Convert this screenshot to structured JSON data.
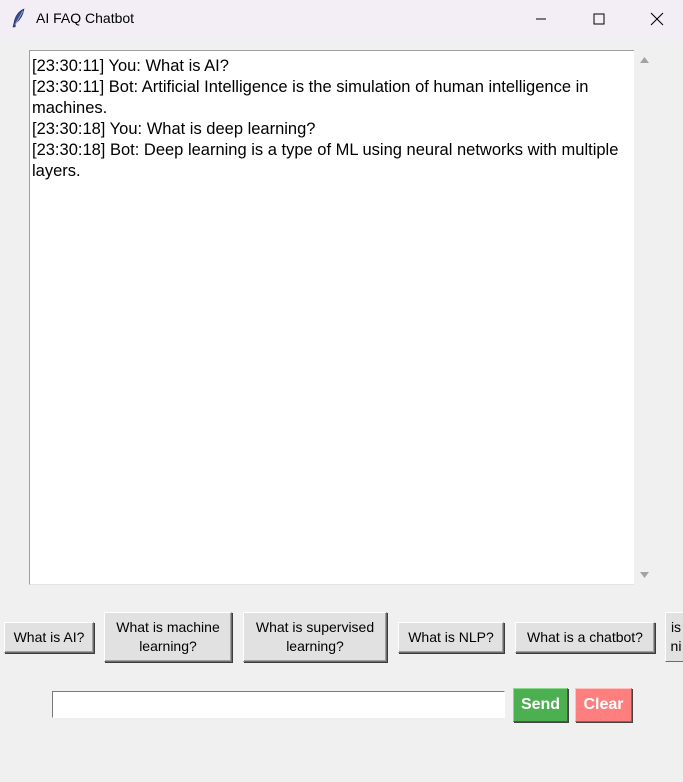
{
  "window": {
    "title": "AI FAQ Chatbot",
    "icon": "feather-icon",
    "controls": [
      "minimize-icon",
      "maximize-icon",
      "close-icon"
    ]
  },
  "chat": {
    "lines": [
      "[23:30:11] You: What is AI?",
      "[23:30:11] Bot: Artificial Intelligence is the simulation of human intelligence in machines.",
      "[23:30:18] You: What is deep learning?",
      "[23:30:18] Bot: Deep learning is a type of ML using neural networks with multiple layers."
    ]
  },
  "quick_questions": [
    "What is AI?",
    "What is machine learning?",
    "What is supervised learning?",
    "What is NLP?",
    "What is a chatbot?",
    "is ni"
  ],
  "input": {
    "value": "",
    "placeholder": ""
  },
  "buttons": {
    "send": "Send",
    "clear": "Clear"
  },
  "colors": {
    "send_bg": "#4caf50",
    "clear_bg": "#ff7f7f",
    "titlebar_bg": "#f3eef6",
    "window_bg": "#f0f0f0"
  }
}
